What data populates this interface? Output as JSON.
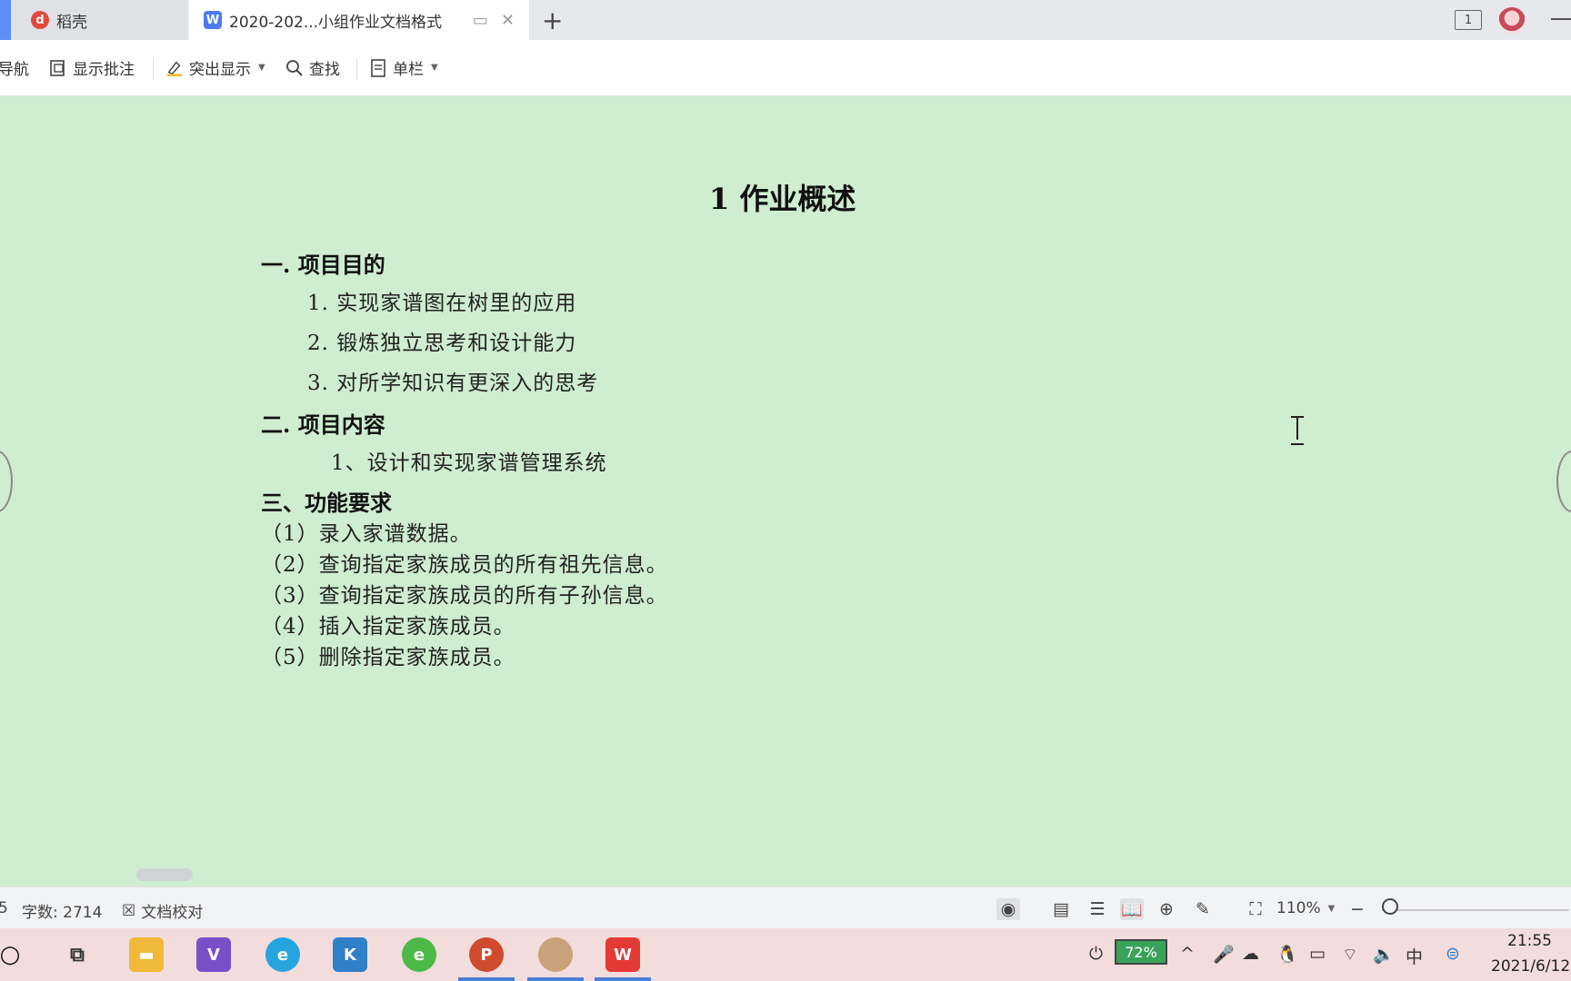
{
  "tabs": {
    "daoke_label": "稻壳",
    "doc_label": "2020-202...小组作业文档格式",
    "new_tab": "+",
    "window_count": "1"
  },
  "toolbar": {
    "nav_label": "导航",
    "show_comments": "显示批注",
    "highlight": "突出显示",
    "find": "查找",
    "single_column": "单栏"
  },
  "document": {
    "title": "1  作业概述",
    "section1": {
      "heading": "一.  项目目的",
      "items": [
        "1. 实现家谱图在树里的应用",
        "2. 锻炼独立思考和设计能力",
        "3. 对所学知识有更深入的思考"
      ]
    },
    "section2": {
      "heading": "二.  项目内容",
      "items": [
        "1、设计和实现家谱管理系统"
      ]
    },
    "section3": {
      "heading": "三、功能要求",
      "items": [
        "（1）录入家谱数据。",
        "（2）查询指定家族成员的所有祖先信息。",
        "（3）查询指定家族成员的所有子孙信息。",
        "（4）插入指定家族成员。",
        "（5）删除指定家族成员。"
      ]
    }
  },
  "statusbar": {
    "page_fragment": "5",
    "word_count": "字数: 2714",
    "proofread": "文档校对",
    "zoom": "110%"
  },
  "taskbar": {
    "battery": "72%",
    "ime": "中",
    "time": "21:55",
    "date": "2021/6/12"
  },
  "colors": {
    "doc_background": "#cfedd0",
    "taskbar_background": "#f3dcdc",
    "accent": "#4b7cf3"
  }
}
